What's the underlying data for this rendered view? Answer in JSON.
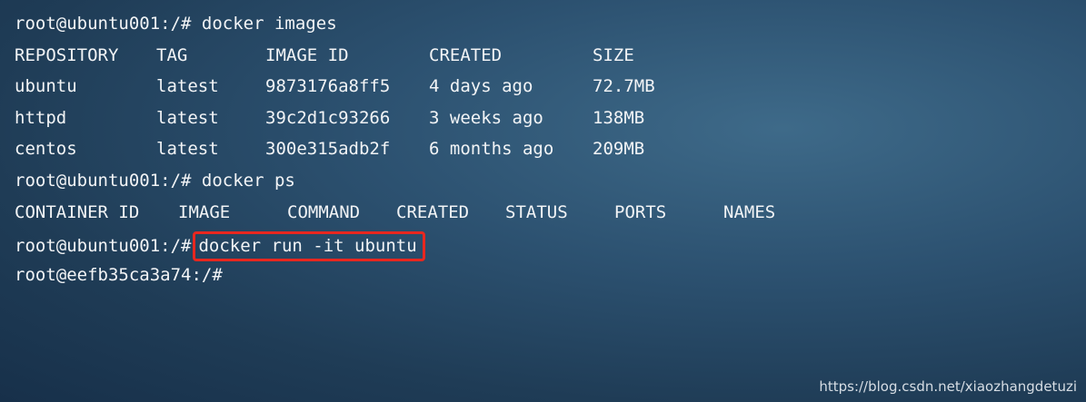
{
  "terminal": {
    "prompt_host": "root@ubuntu001:/#",
    "cmd_images": "docker images",
    "images_headers": [
      "REPOSITORY",
      "TAG",
      "IMAGE ID",
      "CREATED",
      "SIZE"
    ],
    "images_rows": [
      [
        "ubuntu",
        "latest",
        "9873176a8ff5",
        "4 days ago",
        "72.7MB"
      ],
      [
        "httpd",
        "latest",
        "39c2d1c93266",
        "3 weeks ago",
        "138MB"
      ],
      [
        "centos",
        "latest",
        "300e315adb2f",
        "6 months ago",
        "209MB"
      ]
    ],
    "cmd_ps": "docker ps",
    "ps_headers": [
      "CONTAINER ID",
      "IMAGE",
      "COMMAND",
      "CREATED",
      "STATUS",
      "PORTS",
      "NAMES"
    ],
    "cmd_run": "docker run -it ubuntu",
    "prompt_container": "root@eefb35ca3a74:/#"
  },
  "watermark": "https://blog.csdn.net/xiaozhangdetuzi",
  "colors": {
    "highlight_border": "#e8271f",
    "text": "#f2f4f6"
  }
}
